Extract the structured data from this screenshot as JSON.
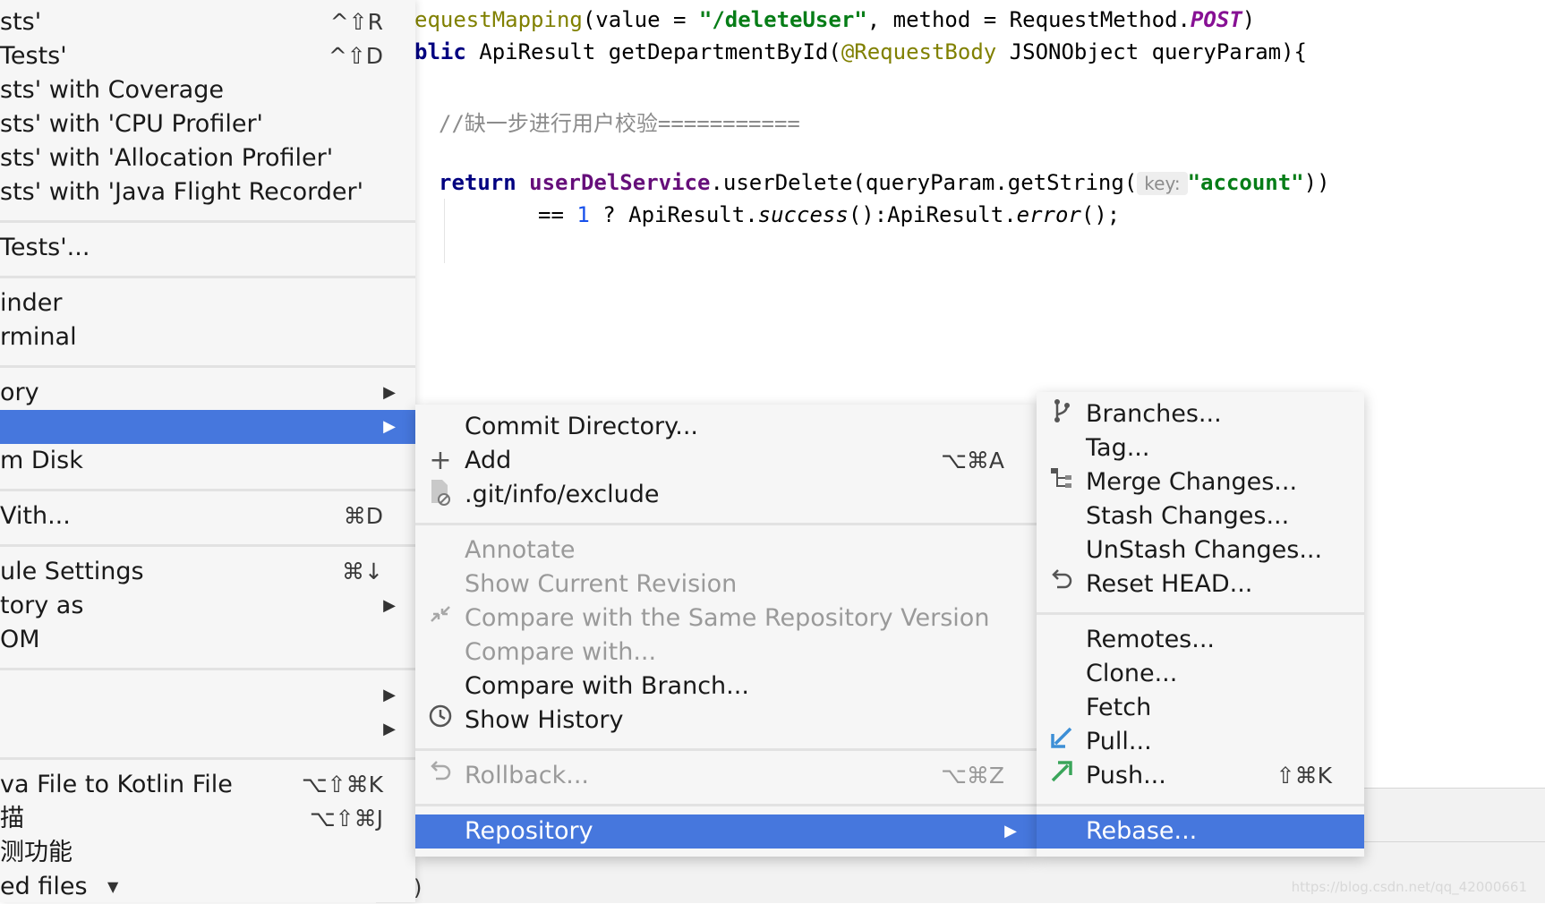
{
  "editor": {
    "line1": {
      "annotation": "equestMapping",
      "open": "(value = ",
      "value": "\"/deleteUser\"",
      "mid": ", method = RequestMethod.",
      "post": "POST",
      "close": ")"
    },
    "line2": {
      "kw": "blic",
      "sig": " ApiResult getDepartmentById(",
      "anno": "@RequestBody",
      "rest": " JSONObject queryParam){"
    },
    "comment": "//缺一步进行用户校验===========",
    "line4": {
      "kw": "return",
      "svc": "userDelService",
      "call": ".userDelete(queryParam.getString(",
      "hint": "key:",
      "arg": "\"account\"",
      "close": "))"
    },
    "line5": {
      "op": "== ",
      "num": "1",
      "mid": " ? ApiResult.",
      "success": "success",
      "mid2": "():ApiResult.",
      "error": "error",
      "end": "();"
    },
    "bottom_text": ")"
  },
  "left_menu": {
    "items": [
      {
        "label": "sts'",
        "shortcut": "^⇧R"
      },
      {
        "label": "Tests'",
        "shortcut": "^⇧D"
      },
      {
        "label": "sts' with Coverage"
      },
      {
        "label": "sts' with 'CPU Profiler'"
      },
      {
        "label": "sts' with 'Allocation Profiler'"
      },
      {
        "label": "sts' with 'Java Flight Recorder'"
      },
      {
        "label": "Tests'..."
      },
      {
        "label": "inder"
      },
      {
        "label": "rminal"
      },
      {
        "label": "ory"
      },
      {
        "label": ""
      },
      {
        "label": "m Disk"
      },
      {
        "label": "Vith...",
        "shortcut": "⌘D"
      },
      {
        "label": "ule Settings",
        "shortcut": "⌘↓"
      },
      {
        "label": "tory as"
      },
      {
        "label": "OM"
      },
      {
        "label": ""
      },
      {
        "label": ""
      },
      {
        "label": "va File to Kotlin File",
        "shortcut": "⌥⇧⌘K"
      },
      {
        "label": "描",
        "shortcut": "⌥⇧⌘J"
      },
      {
        "label": "测功能"
      },
      {
        "label": "ed files"
      }
    ]
  },
  "git_menu": {
    "items": [
      {
        "label": "Commit Directory..."
      },
      {
        "label": "Add",
        "shortcut": "⌥⌘A",
        "icon": "plus-icon"
      },
      {
        "label": ".git/info/exclude",
        "icon": "exclude-file-icon"
      },
      {
        "label": "Annotate"
      },
      {
        "label": "Show Current Revision"
      },
      {
        "label": "Compare with the Same Repository Version",
        "icon": "compare-icon"
      },
      {
        "label": "Compare with..."
      },
      {
        "label": "Compare with Branch..."
      },
      {
        "label": "Show History",
        "icon": "clock-icon"
      },
      {
        "label": "Rollback...",
        "shortcut": "⌥⌘Z",
        "icon": "rollback-icon"
      },
      {
        "label": "Repository"
      }
    ]
  },
  "repo_menu": {
    "items": [
      {
        "label": "Branches...",
        "icon": "branch-icon"
      },
      {
        "label": "Tag..."
      },
      {
        "label": "Merge Changes...",
        "icon": "merge-icon"
      },
      {
        "label": "Stash Changes..."
      },
      {
        "label": "UnStash Changes..."
      },
      {
        "label": "Reset HEAD...",
        "icon": "reset-icon"
      },
      {
        "label": "Remotes..."
      },
      {
        "label": "Clone..."
      },
      {
        "label": "Fetch"
      },
      {
        "label": "Pull...",
        "icon": "pull-icon"
      },
      {
        "label": "Push...",
        "shortcut": "⇧⌘K",
        "icon": "push-icon"
      },
      {
        "label": "Rebase..."
      }
    ]
  },
  "colors": {
    "selection": "#4677dd",
    "pull_icon": "#3d8fd6",
    "push_icon": "#3aa55a"
  },
  "watermark": "https://blog.csdn.net/qq_42000661"
}
